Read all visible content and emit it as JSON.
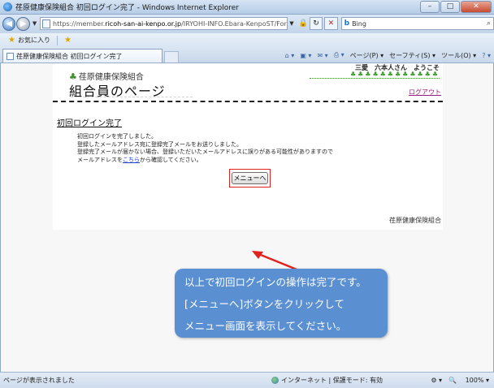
{
  "window": {
    "title": "荏原健康保険組合 初回ログイン完了 - Windows Internet Explorer",
    "min": "–",
    "max": "□",
    "close": "✕"
  },
  "address": {
    "url_prefix": "https://member.",
    "url_host": "ricoh-san-ai-kenpo.or.jp",
    "url_rest": "/IRYOHI-INFO.Ebara-KenpoST/Form",
    "search_label": "Bing"
  },
  "favorites": {
    "label": "お気に入り"
  },
  "tab": {
    "title": "荏原健康保険組合 初回ログイン完了"
  },
  "commands": {
    "page": "ページ(P)",
    "safety": "セーフティ(S)",
    "tools": "ツール(O)"
  },
  "page": {
    "org_name": "荏原健康保険組合",
    "welcome": "三愛　六本人さん　ようこそ",
    "trees": "♣♣♣♣♣♣♣♣♣♣♣♣",
    "title": "組合員のページ",
    "logout": "ログアウト",
    "section_title": "初回ログイン完了",
    "msg_line1": "初回ログインを完了しました。",
    "msg_line2": "登録したメールアドレス宛に登録完了メールをお送りしました。",
    "msg_line3": "登録完了メールが届かない場合、登録いただいたメールアドレスに誤りがある可能性がありますので",
    "msg_line4_pre": "メールアドレスを",
    "msg_line4_link": "こちら",
    "msg_line4_post": "から確認してください。",
    "menu_button": "メニューへ",
    "footer_org": "荏原健康保険組合"
  },
  "callout": {
    "line1": "以上で初回ログインの操作は完了です。",
    "line2": "[メニューへ]ボタンをクリックして",
    "line3": "メニュー画面を表示してください。",
    "color": "#5a8fd1"
  },
  "status": {
    "left": "ページが表示されました",
    "zone": "インターネット | 保護モード: 有効",
    "zoom": "100%"
  },
  "icons": {
    "app": "ie-icon",
    "back": "back-arrow-icon",
    "forward": "forward-arrow-icon",
    "lock": "lock-icon",
    "refresh": "refresh-icon",
    "stop": "stop-icon",
    "search": "search-icon",
    "favorites": "star-icon",
    "home": "home-icon",
    "globe": "globe-icon"
  }
}
